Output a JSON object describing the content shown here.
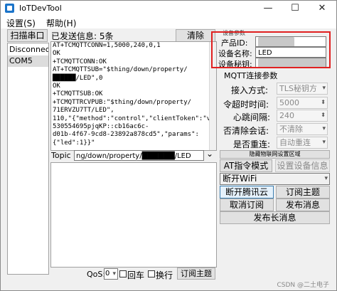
{
  "window": {
    "title": "IoTDevTool",
    "minimize": "—",
    "maximize": "☐",
    "close": "✕"
  },
  "menu": {
    "settings": "设置(S)",
    "help": "帮助(H)"
  },
  "toolbar": {
    "scan_port": "扫描串口",
    "sent_info": "已发送信息: 5条",
    "clear": "清除"
  },
  "sidebar": {
    "items": [
      "Disconnect",
      "COM5"
    ]
  },
  "log": {
    "lines": [
      "AT+TCMQTTCONN=1,5000,240,0,1",
      "OK",
      "+TCMQTTCONN:OK",
      "AT+TCMQTTSUB=\"$thing/down/property/",
      "██████/LED\",0",
      "OK",
      "+TCMQTTSUB:OK",
      "+TCMQTTRCVPUB:\"$thing/down/property/",
      "71ERVZU7TT/LED\",",
      "110,\"{\"method\":\"control\",\"clientToken\":\"v2",
      "530554695pjqKP::cb16ac6c-",
      "d01b-4f67-9cd8-23892a878cd5\",\"params\":",
      "{\"led\":1}}\""
    ]
  },
  "topic": {
    "label": "Topic",
    "value": "ng/down/property/██████/LED"
  },
  "bottom": {
    "qos_label": "QoS:",
    "qos_value": "0",
    "cr_label": "回车",
    "newline_label": "换行",
    "subscribe": "订阅主题"
  },
  "device": {
    "section_title": "设备参数",
    "product_id_label": "产品ID:",
    "product_id_value": "██████",
    "device_name_label": "设备名称:",
    "device_name_value": "LED",
    "device_secret_label": "设备秘钥:",
    "device_secret_value": "████████████"
  },
  "mqtt": {
    "section_title": "MQTT连接参数",
    "access_label": "接入方式:",
    "access_value": "TLS秘钥方",
    "timeout_label": "令超时时间:",
    "timeout_value": "5000",
    "heartbeat_label": "心跳间隔:",
    "heartbeat_value": "240",
    "clean_label": "否清除会话:",
    "clean_value": "不清除",
    "reconnect_label": "是否重连:",
    "reconnect_value": "自动重连"
  },
  "section_hidden": "隐藏物联网设置区域",
  "actions": {
    "at_mode": "AT指令模式",
    "set_device": "设置设备信息",
    "wifi_value": "断开WiFi",
    "disconnect_cloud": "断开腾讯云",
    "subscribe_topic": "订阅主题",
    "unsubscribe": "取消订阅",
    "publish": "发布消息",
    "publish_long": "发布长消息"
  },
  "watermark": "CSDN @二土电子"
}
